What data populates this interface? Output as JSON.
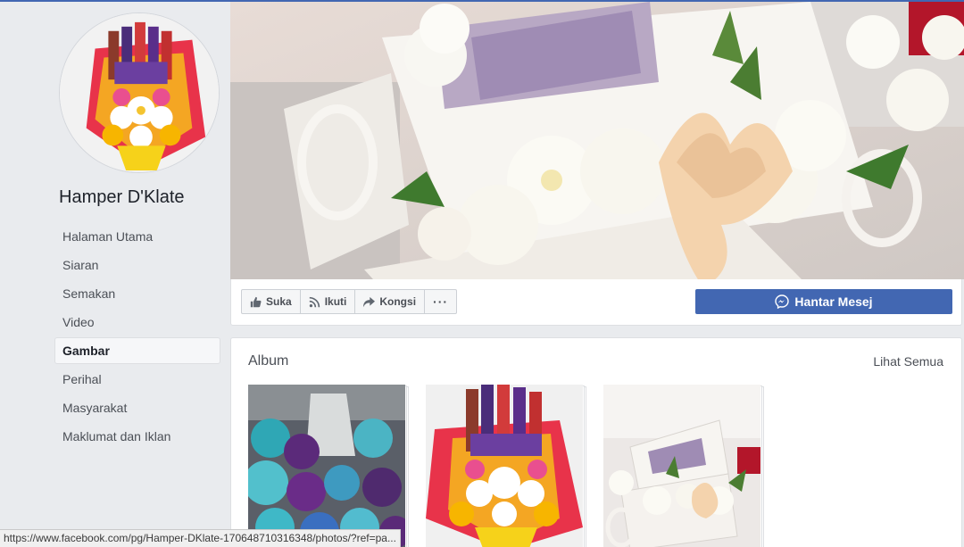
{
  "page": {
    "name": "Hamper D'Klate"
  },
  "nav": {
    "items": [
      {
        "label": "Halaman Utama"
      },
      {
        "label": "Siaran"
      },
      {
        "label": "Semakan"
      },
      {
        "label": "Video"
      },
      {
        "label": "Gambar"
      },
      {
        "label": "Perihal"
      },
      {
        "label": "Masyarakat"
      },
      {
        "label": "Maklumat dan Iklan"
      }
    ],
    "active": "Gambar"
  },
  "actions": {
    "like_label": "Suka",
    "follow_label": "Ikuti",
    "share_label": "Kongsi",
    "more_label": "···",
    "message_label": "Hantar Mesej"
  },
  "album": {
    "title": "Album",
    "see_all": "Lihat Semua"
  },
  "status": {
    "url": "https://www.facebook.com/pg/Hamper-DKlate-170648710316348/photos/?ref=pa..."
  },
  "colors": {
    "brand_blue": "#4267b2",
    "page_bg": "#e9ebee"
  }
}
